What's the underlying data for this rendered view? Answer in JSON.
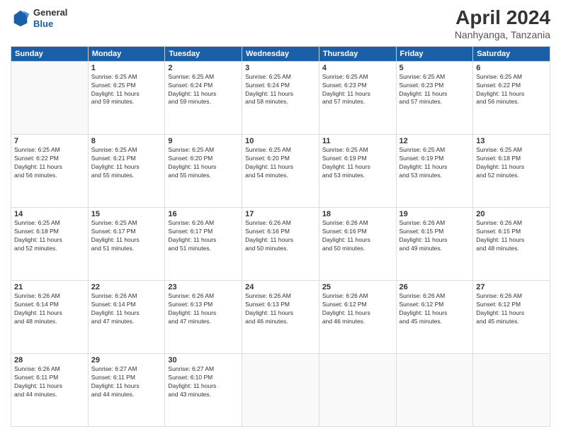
{
  "logo": {
    "general": "General",
    "blue": "Blue"
  },
  "header": {
    "month": "April 2024",
    "location": "Nanhyanga, Tanzania"
  },
  "days_of_week": [
    "Sunday",
    "Monday",
    "Tuesday",
    "Wednesday",
    "Thursday",
    "Friday",
    "Saturday"
  ],
  "weeks": [
    [
      {
        "day": "",
        "info": ""
      },
      {
        "day": "1",
        "info": "Sunrise: 6:25 AM\nSunset: 6:25 PM\nDaylight: 11 hours\nand 59 minutes."
      },
      {
        "day": "2",
        "info": "Sunrise: 6:25 AM\nSunset: 6:24 PM\nDaylight: 11 hours\nand 59 minutes."
      },
      {
        "day": "3",
        "info": "Sunrise: 6:25 AM\nSunset: 6:24 PM\nDaylight: 11 hours\nand 58 minutes."
      },
      {
        "day": "4",
        "info": "Sunrise: 6:25 AM\nSunset: 6:23 PM\nDaylight: 11 hours\nand 57 minutes."
      },
      {
        "day": "5",
        "info": "Sunrise: 6:25 AM\nSunset: 6:23 PM\nDaylight: 11 hours\nand 57 minutes."
      },
      {
        "day": "6",
        "info": "Sunrise: 6:25 AM\nSunset: 6:22 PM\nDaylight: 11 hours\nand 56 minutes."
      }
    ],
    [
      {
        "day": "7",
        "info": "Sunrise: 6:25 AM\nSunset: 6:22 PM\nDaylight: 11 hours\nand 56 minutes."
      },
      {
        "day": "8",
        "info": "Sunrise: 6:25 AM\nSunset: 6:21 PM\nDaylight: 11 hours\nand 55 minutes."
      },
      {
        "day": "9",
        "info": "Sunrise: 6:25 AM\nSunset: 6:20 PM\nDaylight: 11 hours\nand 55 minutes."
      },
      {
        "day": "10",
        "info": "Sunrise: 6:25 AM\nSunset: 6:20 PM\nDaylight: 11 hours\nand 54 minutes."
      },
      {
        "day": "11",
        "info": "Sunrise: 6:25 AM\nSunset: 6:19 PM\nDaylight: 11 hours\nand 53 minutes."
      },
      {
        "day": "12",
        "info": "Sunrise: 6:25 AM\nSunset: 6:19 PM\nDaylight: 11 hours\nand 53 minutes."
      },
      {
        "day": "13",
        "info": "Sunrise: 6:25 AM\nSunset: 6:18 PM\nDaylight: 11 hours\nand 52 minutes."
      }
    ],
    [
      {
        "day": "14",
        "info": "Sunrise: 6:25 AM\nSunset: 6:18 PM\nDaylight: 11 hours\nand 52 minutes."
      },
      {
        "day": "15",
        "info": "Sunrise: 6:25 AM\nSunset: 6:17 PM\nDaylight: 11 hours\nand 51 minutes."
      },
      {
        "day": "16",
        "info": "Sunrise: 6:26 AM\nSunset: 6:17 PM\nDaylight: 11 hours\nand 51 minutes."
      },
      {
        "day": "17",
        "info": "Sunrise: 6:26 AM\nSunset: 6:16 PM\nDaylight: 11 hours\nand 50 minutes."
      },
      {
        "day": "18",
        "info": "Sunrise: 6:26 AM\nSunset: 6:16 PM\nDaylight: 11 hours\nand 50 minutes."
      },
      {
        "day": "19",
        "info": "Sunrise: 6:26 AM\nSunset: 6:15 PM\nDaylight: 11 hours\nand 49 minutes."
      },
      {
        "day": "20",
        "info": "Sunrise: 6:26 AM\nSunset: 6:15 PM\nDaylight: 11 hours\nand 48 minutes."
      }
    ],
    [
      {
        "day": "21",
        "info": "Sunrise: 6:26 AM\nSunset: 6:14 PM\nDaylight: 11 hours\nand 48 minutes."
      },
      {
        "day": "22",
        "info": "Sunrise: 6:26 AM\nSunset: 6:14 PM\nDaylight: 11 hours\nand 47 minutes."
      },
      {
        "day": "23",
        "info": "Sunrise: 6:26 AM\nSunset: 6:13 PM\nDaylight: 11 hours\nand 47 minutes."
      },
      {
        "day": "24",
        "info": "Sunrise: 6:26 AM\nSunset: 6:13 PM\nDaylight: 11 hours\nand 46 minutes."
      },
      {
        "day": "25",
        "info": "Sunrise: 6:26 AM\nSunset: 6:12 PM\nDaylight: 11 hours\nand 46 minutes."
      },
      {
        "day": "26",
        "info": "Sunrise: 6:26 AM\nSunset: 6:12 PM\nDaylight: 11 hours\nand 45 minutes."
      },
      {
        "day": "27",
        "info": "Sunrise: 6:26 AM\nSunset: 6:12 PM\nDaylight: 11 hours\nand 45 minutes."
      }
    ],
    [
      {
        "day": "28",
        "info": "Sunrise: 6:26 AM\nSunset: 6:11 PM\nDaylight: 11 hours\nand 44 minutes."
      },
      {
        "day": "29",
        "info": "Sunrise: 6:27 AM\nSunset: 6:11 PM\nDaylight: 11 hours\nand 44 minutes."
      },
      {
        "day": "30",
        "info": "Sunrise: 6:27 AM\nSunset: 6:10 PM\nDaylight: 11 hours\nand 43 minutes."
      },
      {
        "day": "",
        "info": ""
      },
      {
        "day": "",
        "info": ""
      },
      {
        "day": "",
        "info": ""
      },
      {
        "day": "",
        "info": ""
      }
    ]
  ]
}
